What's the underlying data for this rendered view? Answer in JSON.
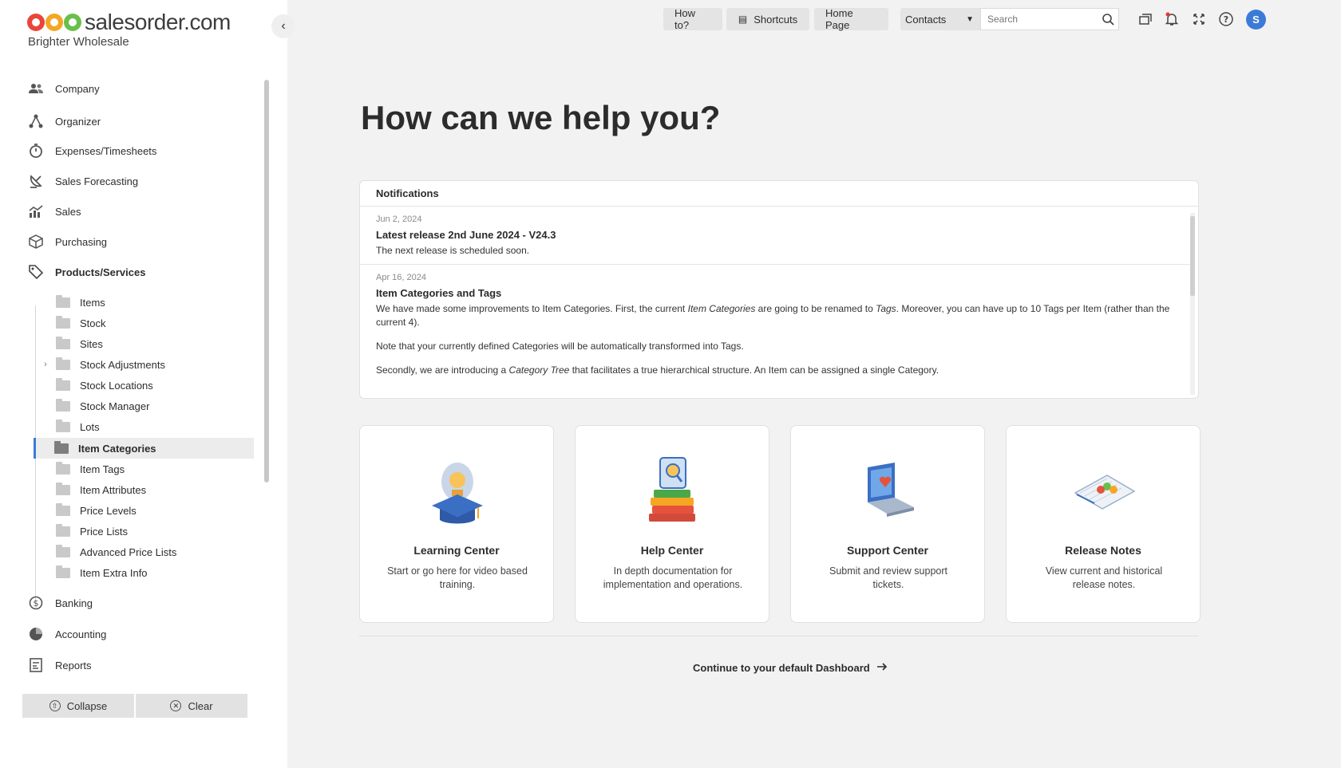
{
  "brand": {
    "name": "salesorder.com",
    "company": "Brighter Wholesale",
    "gear_colors": [
      "#e8453c",
      "#f5a623",
      "#6abf4b"
    ]
  },
  "sidebar": {
    "items": [
      {
        "label": "Company",
        "icon": "people-icon"
      },
      {
        "label": "Organizer",
        "icon": "network-icon"
      },
      {
        "label": "Expenses/Timesheets",
        "icon": "stopwatch-icon"
      },
      {
        "label": "Sales Forecasting",
        "icon": "satellite-dish-icon"
      },
      {
        "label": "Sales",
        "icon": "chart-icon"
      },
      {
        "label": "Purchasing",
        "icon": "box-icon"
      },
      {
        "label": "Products/Services",
        "icon": "tag-icon"
      },
      {
        "label": "Banking",
        "icon": "dollar-icon"
      },
      {
        "label": "Accounting",
        "icon": "pie-icon"
      },
      {
        "label": "Reports",
        "icon": "report-icon"
      }
    ],
    "sub_items": [
      "Items",
      "Stock",
      "Sites",
      "Stock Adjustments",
      "Stock Locations",
      "Stock Manager",
      "Lots",
      "Item Categories",
      "Item Tags",
      "Item Attributes",
      "Price Levels",
      "Price Lists",
      "Advanced Price Lists",
      "Item Extra Info"
    ],
    "active_sub": "Item Categories",
    "collapse_label": "Collapse",
    "clear_label": "Clear"
  },
  "topbar": {
    "how_to": "How to?",
    "shortcuts": "Shortcuts",
    "home_page": "Home Page",
    "search_scope": "Contacts",
    "search_placeholder": "Search",
    "avatar_initial": "S"
  },
  "main": {
    "headline": "How can we help you?",
    "notifications": {
      "title": "Notifications",
      "entries": [
        {
          "date": "Jun 2, 2024",
          "title": "Latest release 2nd June 2024 - V24.3",
          "text": "The next release is scheduled soon."
        },
        {
          "date": "Apr 16, 2024",
          "title": "Item Categories and Tags",
          "p1_a": "We have made some improvements to Item Categories. First, the current ",
          "p1_em1": "Item Categories",
          "p1_b": " are going to be renamed to ",
          "p1_em2": "Tags",
          "p1_c": ". Moreover, you can have up to 10 Tags per Item (rather than the current 4).",
          "p2": "Note that your currently defined Categories will be automatically transformed into Tags.",
          "p3_a": "Secondly, we are introducing a ",
          "p3_em": "Category Tree",
          "p3_b": " that facilitates a true hierarchical structure. An Item can be assigned a single Category."
        }
      ]
    },
    "cards": [
      {
        "title": "Learning Center",
        "desc": "Start or go here for video based training.",
        "icon": "graduation-cap-icon"
      },
      {
        "title": "Help Center",
        "desc": "In depth documentation for implementation and operations.",
        "icon": "books-icon"
      },
      {
        "title": "Support Center",
        "desc": "Submit and review support tickets.",
        "icon": "laptop-heart-icon"
      },
      {
        "title": "Release Notes",
        "desc": "View current and historical release notes.",
        "icon": "notebook-icon"
      }
    ],
    "continue_label": "Continue to your default Dashboard"
  }
}
